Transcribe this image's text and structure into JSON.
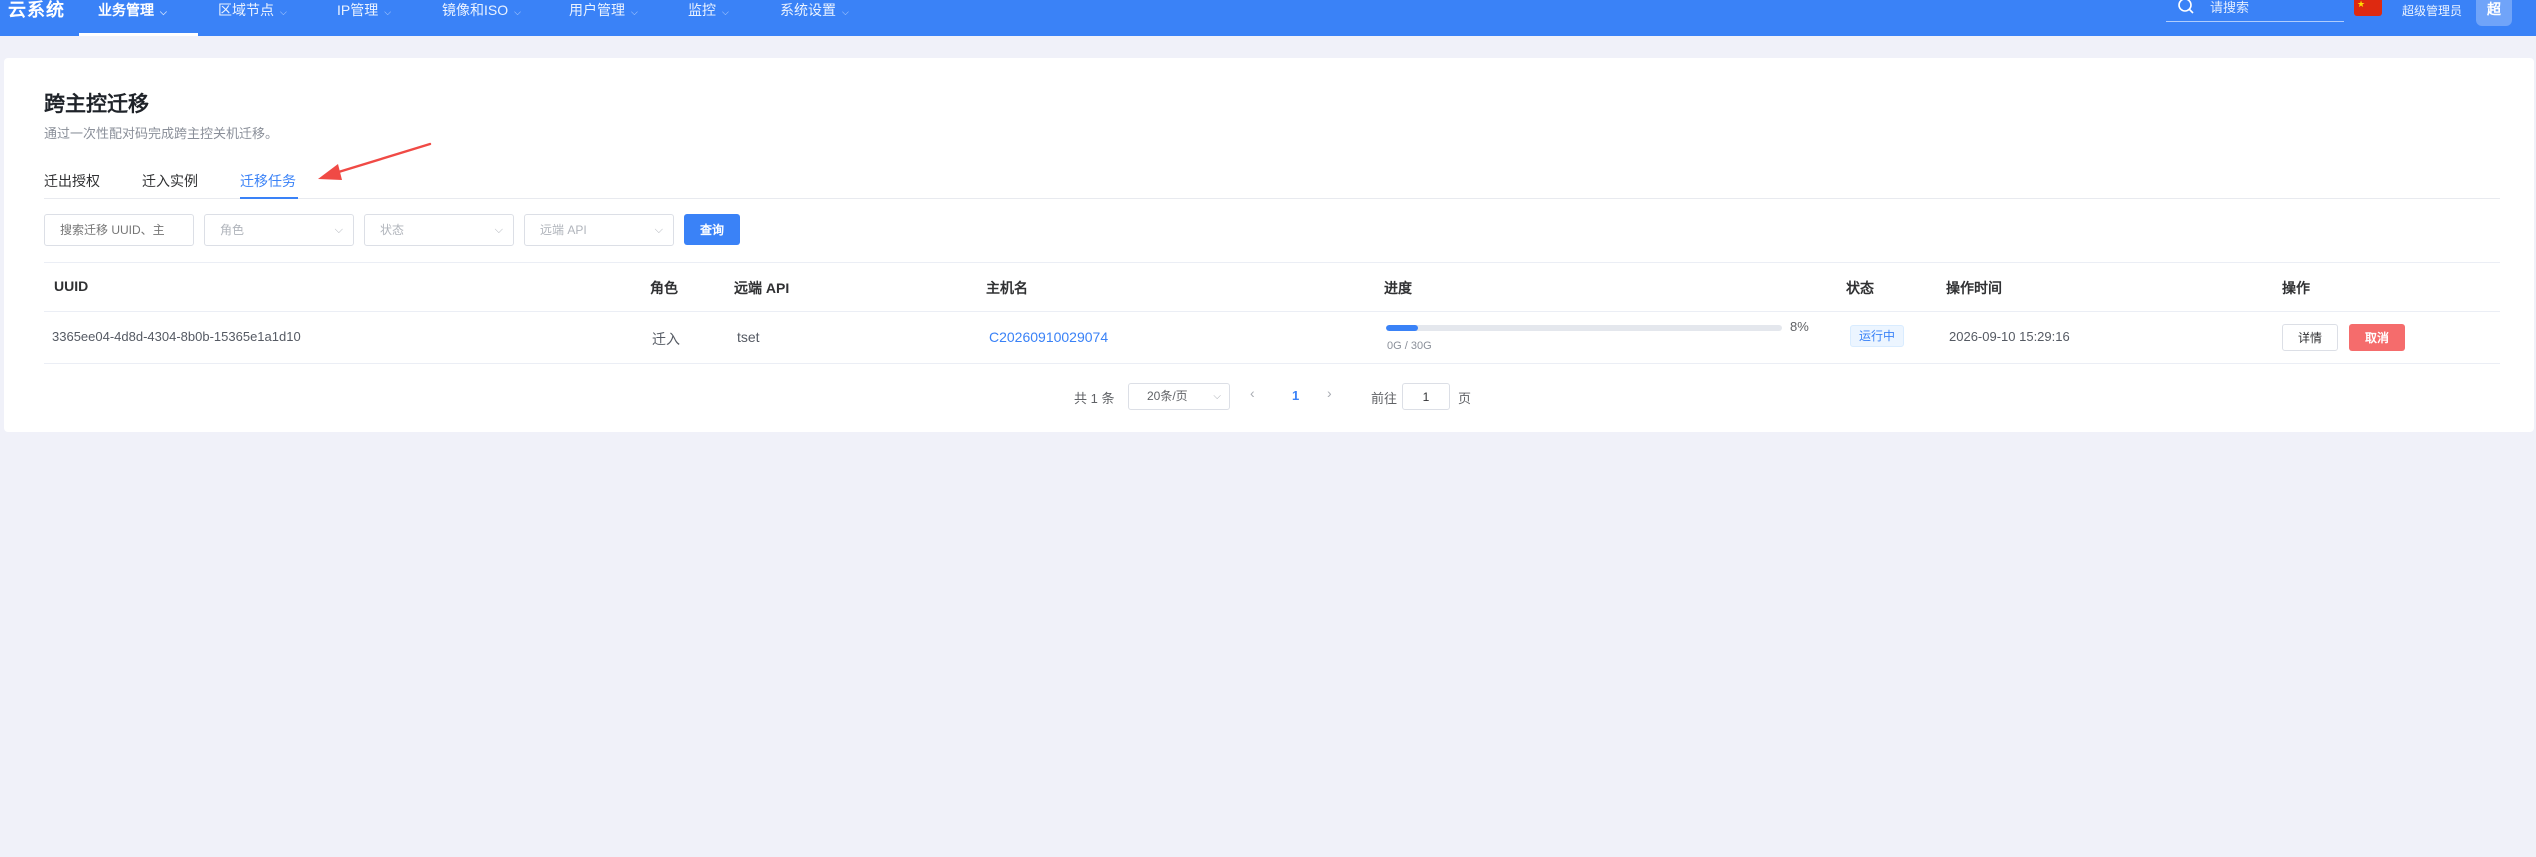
{
  "nav": {
    "brand": "云系统",
    "items": [
      {
        "label": "业务管理"
      },
      {
        "label": "区域节点"
      },
      {
        "label": "IP管理"
      },
      {
        "label": "镜像和ISO"
      },
      {
        "label": "用户管理"
      },
      {
        "label": "监控"
      },
      {
        "label": "系统设置"
      }
    ],
    "search_placeholder": "请搜索",
    "admin_name": "超级管理员",
    "avatar_text": "超"
  },
  "page": {
    "title": "跨主控迁移",
    "description": "通过一次性配对码完成跨主控关机迁移。",
    "tabs": [
      {
        "label": "迁出授权"
      },
      {
        "label": "迁入实例"
      },
      {
        "label": "迁移任务"
      }
    ],
    "active_tab": "迁移任务"
  },
  "filters": {
    "search_placeholder": "搜索迁移 UUID、主",
    "role_placeholder": "角色",
    "status_placeholder": "状态",
    "remote_api_placeholder": "远端 API",
    "query_label": "查询"
  },
  "table": {
    "columns": [
      "UUID",
      "角色",
      "远端 API",
      "主机名",
      "进度",
      "状态",
      "操作时间",
      "操作"
    ],
    "rows": [
      {
        "uuid": "3365ee04-4d8d-4304-8b0b-15365e1a1d10",
        "role": "迁入",
        "remote_api": "tset",
        "hostname": "C20260910029074",
        "progress_percent": 8,
        "progress_label": "8%",
        "progress_detail": "0G / 30G",
        "status": "运行中",
        "time": "2026-09-10 15:29:16",
        "detail_label": "详情",
        "cancel_label": "取消"
      }
    ]
  },
  "pagination": {
    "total": "共 1 条",
    "page_size": "20条/页",
    "current_page": "1",
    "goto_label": "前往",
    "goto_value": "1",
    "page_suffix": "页"
  },
  "colors": {
    "primary": "#3a82f7",
    "danger": "#f56c6c",
    "annotation_arrow": "#f04a45"
  }
}
